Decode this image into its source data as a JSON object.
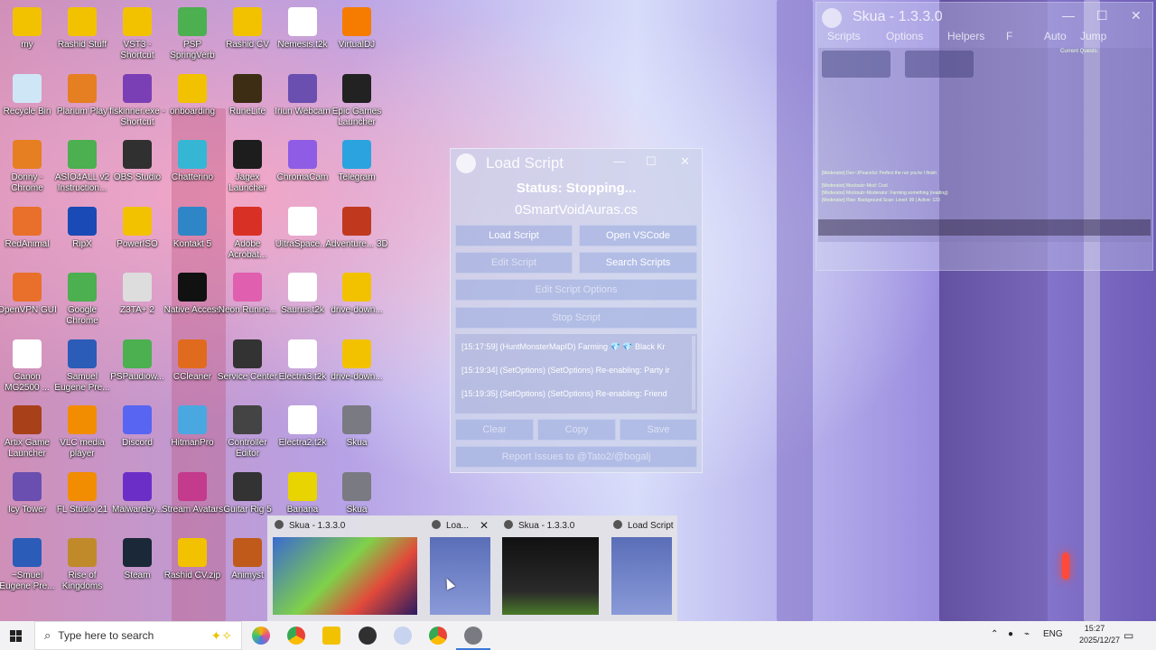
{
  "desktop_icons": [
    {
      "label": "my",
      "icon": "folder-icon",
      "color": "#f2c200"
    },
    {
      "label": "Rashid Stuff",
      "icon": "folder-icon",
      "color": "#f2c200"
    },
    {
      "label": "VST3 - Shortcut",
      "icon": "folder-icon",
      "color": "#f2c200"
    },
    {
      "label": "PSP SpringVerb",
      "icon": "chrome-icon",
      "color": "#4caf50"
    },
    {
      "label": "Rashid CV",
      "icon": "zip-icon",
      "color": "#f2c200"
    },
    {
      "label": "Nemesis.t2k",
      "icon": "file-icon",
      "color": "#ffffff"
    },
    {
      "label": "VirtualDJ",
      "icon": "virtualdj-icon",
      "color": "#f57c00"
    },
    {
      "label": "Recycle Bin",
      "icon": "recycle-bin-icon",
      "color": "#cfe6f7"
    },
    {
      "label": "Plarium Play",
      "icon": "plarium-icon",
      "color": "#e67e22"
    },
    {
      "label": "flskinner.exe - Shortcut",
      "icon": "flskinner-icon",
      "color": "#7b3fb5"
    },
    {
      "label": "onboarding",
      "icon": "folder-icon",
      "color": "#f2c200"
    },
    {
      "label": "RuneLite",
      "icon": "runelite-icon",
      "color": "#3d2d15"
    },
    {
      "label": "Iriun Webcam",
      "icon": "webcam-icon",
      "color": "#6a4fb0"
    },
    {
      "label": "Epic Games Launcher",
      "icon": "epic-icon",
      "color": "#222222"
    },
    {
      "label": "Donny - Chrome",
      "icon": "chrome-icon",
      "color": "#e67e22"
    },
    {
      "label": "ASIO4ALL v2 Instruction...",
      "icon": "chrome-icon",
      "color": "#4caf50"
    },
    {
      "label": "OBS Studio",
      "icon": "obs-icon",
      "color": "#303030"
    },
    {
      "label": "Chatterino",
      "icon": "chatterino-icon",
      "color": "#35b6d5"
    },
    {
      "label": "Jagex Launcher",
      "icon": "jagex-icon",
      "color": "#1d1d1d"
    },
    {
      "label": "ChromaCam",
      "icon": "chromacam-icon",
      "color": "#8f5ce6"
    },
    {
      "label": "Telegram",
      "icon": "telegram-icon",
      "color": "#2aa3df"
    },
    {
      "label": "RedAnimal",
      "icon": "redanimal-icon",
      "color": "#e9702a"
    },
    {
      "label": "RipX",
      "icon": "ripx-icon",
      "color": "#1a4ab5"
    },
    {
      "label": "PowerISO",
      "icon": "poweriso-icon",
      "color": "#f2c200"
    },
    {
      "label": "Kontakt 5",
      "icon": "kontakt-icon",
      "color": "#2f86c7"
    },
    {
      "label": "Adobe Acrobat...",
      "icon": "pdf-icon",
      "color": "#d93025"
    },
    {
      "label": "UltraSpace....",
      "icon": "file-icon",
      "color": "#ffffff"
    },
    {
      "label": "Adventure... 3D",
      "icon": "adventure-icon",
      "color": "#c0391e"
    },
    {
      "label": "OpenVPN GUI",
      "icon": "openvpn-icon",
      "color": "#e9702a"
    },
    {
      "label": "Google Chrome",
      "icon": "chrome-icon",
      "color": "#4caf50"
    },
    {
      "label": "Z3TA+ 2",
      "icon": "z3ta-icon",
      "color": "#dddddd"
    },
    {
      "label": "Native Access",
      "icon": "native-access-icon",
      "color": "#111111"
    },
    {
      "label": "Neon Runne...",
      "icon": "neon-icon",
      "color": "#e05fae"
    },
    {
      "label": "Saurus.t2k",
      "icon": "file-icon",
      "color": "#ffffff"
    },
    {
      "label": "drive-down...",
      "icon": "zip-icon",
      "color": "#f2c200"
    },
    {
      "label": "Canon MG2500 ...",
      "icon": "printer-icon",
      "color": "#ffffff"
    },
    {
      "label": "Samuel Eugene Pre...",
      "icon": "word-icon",
      "color": "#2b5cb8"
    },
    {
      "label": "PSPaudiow...",
      "icon": "chrome-icon",
      "color": "#4caf50"
    },
    {
      "label": "CCleaner",
      "icon": "ccleaner-icon",
      "color": "#e06b1f"
    },
    {
      "label": "Service Center",
      "icon": "service-center-icon",
      "color": "#333333"
    },
    {
      "label": "Electra3.t2k",
      "icon": "file-icon",
      "color": "#ffffff"
    },
    {
      "label": "drive-down...",
      "icon": "zip-icon",
      "color": "#f2c200"
    },
    {
      "label": "Artix Game Launcher",
      "icon": "artix-icon",
      "color": "#a8401a"
    },
    {
      "label": "VLC media player",
      "icon": "vlc-icon",
      "color": "#f28c00"
    },
    {
      "label": "Discord",
      "icon": "discord-icon",
      "color": "#5865f2"
    },
    {
      "label": "HitmanPro",
      "icon": "hitmanpro-icon",
      "color": "#4aa8e0"
    },
    {
      "label": "Controller Editor",
      "icon": "controller-editor-icon",
      "color": "#444444"
    },
    {
      "label": "Electra2.t2k",
      "icon": "file-icon",
      "color": "#ffffff"
    },
    {
      "label": "Skua",
      "icon": "skua-icon",
      "color": "#7a7a82"
    },
    {
      "label": "Icy Tower",
      "icon": "icy-tower-icon",
      "color": "#6a4fb0"
    },
    {
      "label": "FL Studio 21",
      "icon": "fl-studio-icon",
      "color": "#f28c00"
    },
    {
      "label": "Malwareby...",
      "icon": "malwarebytes-icon",
      "color": "#6b2fc8"
    },
    {
      "label": "Stream Avatars",
      "icon": "stream-avatars-icon",
      "color": "#c43a8c"
    },
    {
      "label": "Guitar Rig 5",
      "icon": "guitar-rig-icon",
      "color": "#333333"
    },
    {
      "label": "Banana",
      "icon": "banana-icon",
      "color": "#e8d400"
    },
    {
      "label": "Skua",
      "icon": "skua-icon",
      "color": "#7a7a82"
    },
    {
      "label": "~Smuel Eugene Pre...",
      "icon": "word-icon",
      "color": "#2b5cb8"
    },
    {
      "label": "Rise of Kingdoms",
      "icon": "rise-of-kingdoms-icon",
      "color": "#c08a2a"
    },
    {
      "label": "Steam",
      "icon": "steam-icon",
      "color": "#1b2838"
    },
    {
      "label": "Rashid CV.zip",
      "icon": "zip-icon",
      "color": "#f2c200"
    },
    {
      "label": "Animyst",
      "icon": "animyst-icon",
      "color": "#c05a1a"
    }
  ],
  "skua_main": {
    "title": "Skua - 1.3.3.0",
    "menu": [
      "Scripts",
      "Options",
      "Helpers",
      "F",
      "Auto",
      "Jump"
    ],
    "quest_label": "Current Quests:",
    "chat_lines": [
      "[Moderator] Dev~JPeaceful: Perfect the run you're I finish",
      "[Moderator] Mocksub~Mod: Cool",
      "[Moderator] Mocksub~Moderator: Farming something (reading)",
      "[Moderator] Rise: Background Scan: Level: 99 | Active: 123"
    ]
  },
  "load_script": {
    "title": "Load Script",
    "status": "Status: Stopping...",
    "file": "0SmartVoidAuras.cs",
    "buttons": {
      "load": "Load Script",
      "vscode": "Open VSCode",
      "edit": "Edit Script",
      "search": "Search Scripts",
      "edit_options": "Edit Script Options",
      "stop": "Stop Script",
      "clear": "Clear",
      "copy": "Copy",
      "save": "Save",
      "report": "Report Issues to @Tato2/@bogalj"
    },
    "log": [
      "[15:17:59] (HuntMonsterMapID)  Farming  💎  💎  Black Kr",
      "[15:19:34] (SetOptions)  (SetOptions) Re-enabling: Party ir",
      "[15:19:35] (SetOptions)  (SetOptions) Re-enabling: Friend"
    ]
  },
  "taskbar_preview": [
    {
      "title": "Skua - 1.3.3.0"
    },
    {
      "title": "Loa..."
    },
    {
      "title": "Skua - 1.3.3.0"
    },
    {
      "title": "Load Script"
    }
  ],
  "taskbar": {
    "search_placeholder": "Type here to search",
    "language": "ENG",
    "time": "15:27",
    "date": "2025/12/27"
  }
}
